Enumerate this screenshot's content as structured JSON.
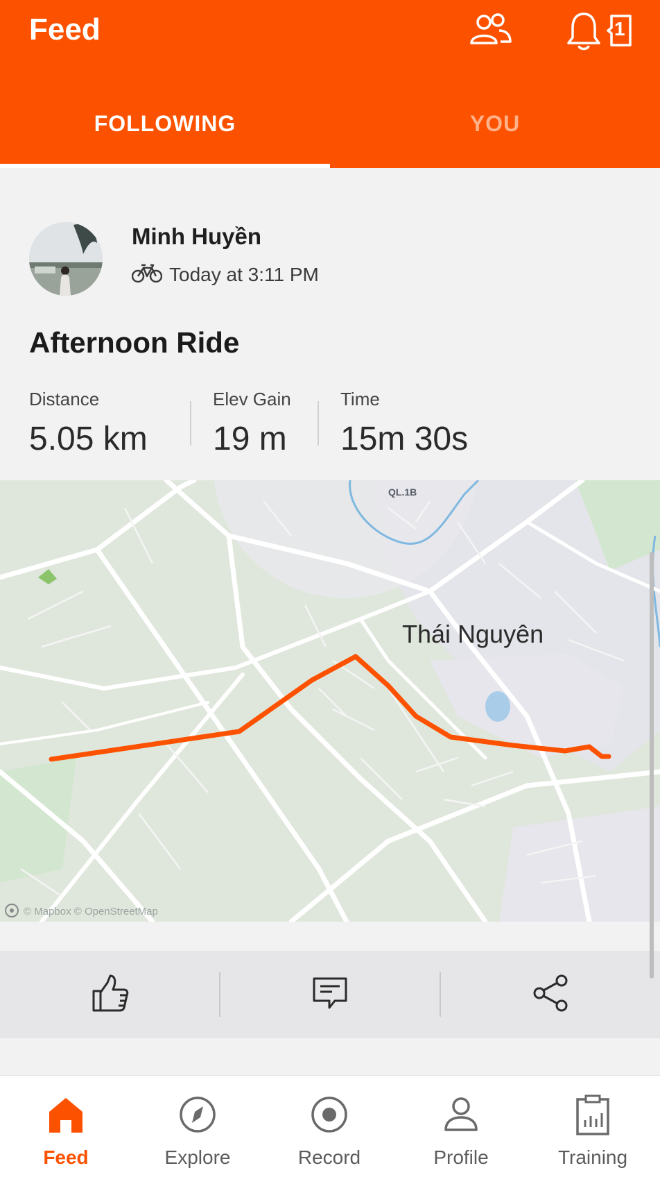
{
  "header": {
    "title": "Feed",
    "notification_count": "1",
    "icons": [
      "friends-icon",
      "notifications-bell-icon",
      "inbox-badge-icon"
    ]
  },
  "tabs": [
    {
      "label": "FOLLOWING",
      "active": true
    },
    {
      "label": "YOU",
      "active": false
    }
  ],
  "activity": {
    "athlete_name": "Minh Huyền",
    "sport_icon": "bike-icon",
    "timestamp": "Today at 3:11 PM",
    "title": "Afternoon Ride",
    "stats": [
      {
        "label": "Distance",
        "value": "5.05 km"
      },
      {
        "label": "Elev Gain",
        "value": "19 m"
      },
      {
        "label": "Time",
        "value": "15m 30s"
      }
    ],
    "map": {
      "city_label": "Thái Nguyên",
      "road_label": "QL.1B",
      "attribution": "© Mapbox © OpenStreetMap",
      "route_color": "#fc5200"
    }
  },
  "actions": [
    {
      "name": "kudos",
      "icon": "thumbs-up-icon"
    },
    {
      "name": "comment",
      "icon": "comment-icon"
    },
    {
      "name": "share",
      "icon": "share-icon"
    }
  ],
  "bottom_nav": [
    {
      "label": "Feed",
      "icon": "home-icon",
      "active": true
    },
    {
      "label": "Explore",
      "icon": "compass-icon",
      "active": false
    },
    {
      "label": "Record",
      "icon": "record-icon",
      "active": false
    },
    {
      "label": "Profile",
      "icon": "profile-icon",
      "active": false
    },
    {
      "label": "Training",
      "icon": "training-clipboard-icon",
      "active": false
    }
  ],
  "colors": {
    "brand": "#fc5200",
    "tab_inactive": "#ffb28a",
    "map_background": "#dfe7dc",
    "water": "#7fb8e0"
  }
}
